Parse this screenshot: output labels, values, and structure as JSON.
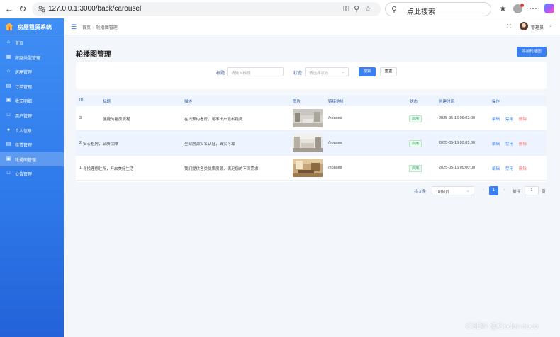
{
  "browser": {
    "url": "127.0.0.1:3000/back/carousel",
    "search_placeholder": "点此搜索"
  },
  "sidebar": {
    "app_title": "房屋租赁系统",
    "items": [
      {
        "label": "首页",
        "icon": "home-icon",
        "active": false
      },
      {
        "label": "房屋类型管理",
        "icon": "grid-icon",
        "active": false
      },
      {
        "label": "房屋管理",
        "icon": "house-icon",
        "active": false
      },
      {
        "label": "订单管理",
        "icon": "document-icon",
        "active": false
      },
      {
        "label": "收支明细",
        "icon": "wallet-icon",
        "active": false
      },
      {
        "label": "用户管理",
        "icon": "chat-icon",
        "active": false
      },
      {
        "label": "个人信息",
        "icon": "user-icon",
        "active": false
      },
      {
        "label": "租赁管理",
        "icon": "file-icon",
        "active": false
      },
      {
        "label": "轮播图管理",
        "icon": "image-icon",
        "active": true
      },
      {
        "label": "公告管理",
        "icon": "notice-icon",
        "active": false
      }
    ]
  },
  "header": {
    "breadcrumb": [
      "首页",
      "轮播图管理"
    ],
    "user_name": "管理员"
  },
  "page": {
    "title": "轮播图管理",
    "add_button": "添加轮播图"
  },
  "filters": {
    "title_label": "标题",
    "title_placeholder": "请输入标题",
    "status_label": "状态",
    "status_placeholder": "请选择状态",
    "search_button": "搜索",
    "reset_button": "重置"
  },
  "table": {
    "columns": [
      "ID",
      "标题",
      "描述",
      "图片",
      "链接地址",
      "状态",
      "创建时间",
      "操作"
    ],
    "rows": [
      {
        "id": "3",
        "title": "便捷的租房流程",
        "desc": "在线预约看房，足不出户轻松租房",
        "link": "/houses",
        "status": "启用",
        "created": "2025-05-15 09:02:00",
        "actions": [
          "编辑",
          "禁用",
          "删除"
        ]
      },
      {
        "id": "2",
        "title": "安心租房，品质保障",
        "desc": "全部房源实名认证，真实可靠",
        "link": "/houses",
        "status": "启用",
        "created": "2025-05-15 09:01:00",
        "actions": [
          "编辑",
          "禁用",
          "删除"
        ]
      },
      {
        "id": "1",
        "title": "寻找理想住所，开启美好生活",
        "desc": "我们提供各类优质房源，满足您的不同需求",
        "link": "/houses",
        "status": "启用",
        "created": "2025-05-15 09:00:00",
        "actions": [
          "编辑",
          "禁用",
          "删除"
        ]
      }
    ]
  },
  "pagination": {
    "total": "共 3 条",
    "page_size": "10条/页",
    "current": "1",
    "goto_label": "前往",
    "goto_value": "1",
    "unit": "页"
  },
  "watermark": "CSDN @Coder-coco",
  "colors": {
    "primary": "#3a80f0",
    "sidebar_top": "#3f8ef4",
    "sidebar_bottom": "#2362d8",
    "success": "#2eae5c",
    "danger": "#f56c6c"
  }
}
